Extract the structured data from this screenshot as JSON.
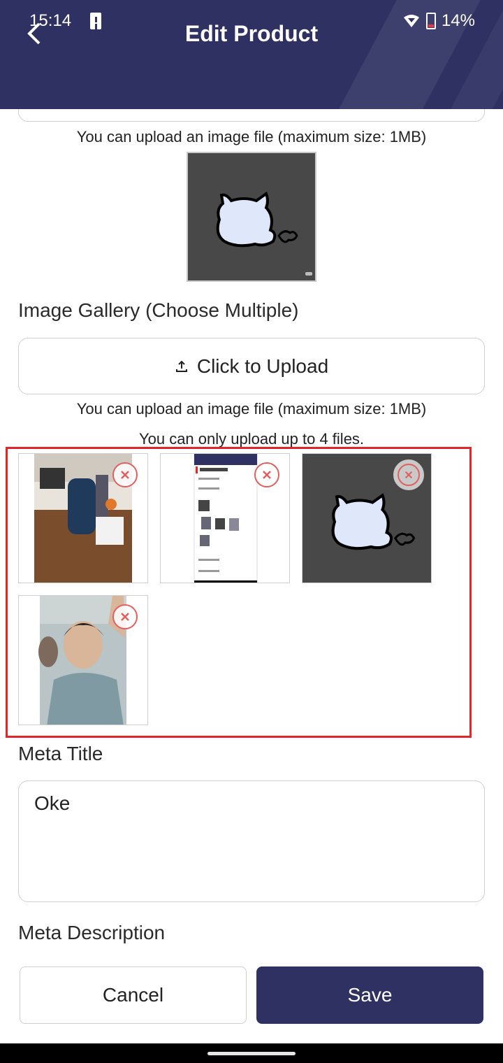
{
  "status_bar": {
    "time": "15:14",
    "battery": "14%"
  },
  "header": {
    "title": "Edit Product"
  },
  "image": {
    "help": "You can upload an image file (maximum size: 1MB)"
  },
  "gallery": {
    "label": "Image Gallery (Choose Multiple)",
    "upload_label": "Click to Upload",
    "help_size": "You can upload an image file (maximum size: 1MB)",
    "help_limit": "You can only upload up to 4 files."
  },
  "meta_title": {
    "label": "Meta Title",
    "value": "Oke"
  },
  "meta_description": {
    "label": "Meta Description"
  },
  "actions": {
    "cancel": "Cancel",
    "save": "Save"
  },
  "colors": {
    "primary": "#2f3162",
    "highlight": "#e0252b",
    "remove": "#e06060"
  },
  "icons": [
    "back-arrow-icon",
    "battery-alert-icon",
    "wifi-icon",
    "battery-icon",
    "upload-icon",
    "remove-icon"
  ]
}
